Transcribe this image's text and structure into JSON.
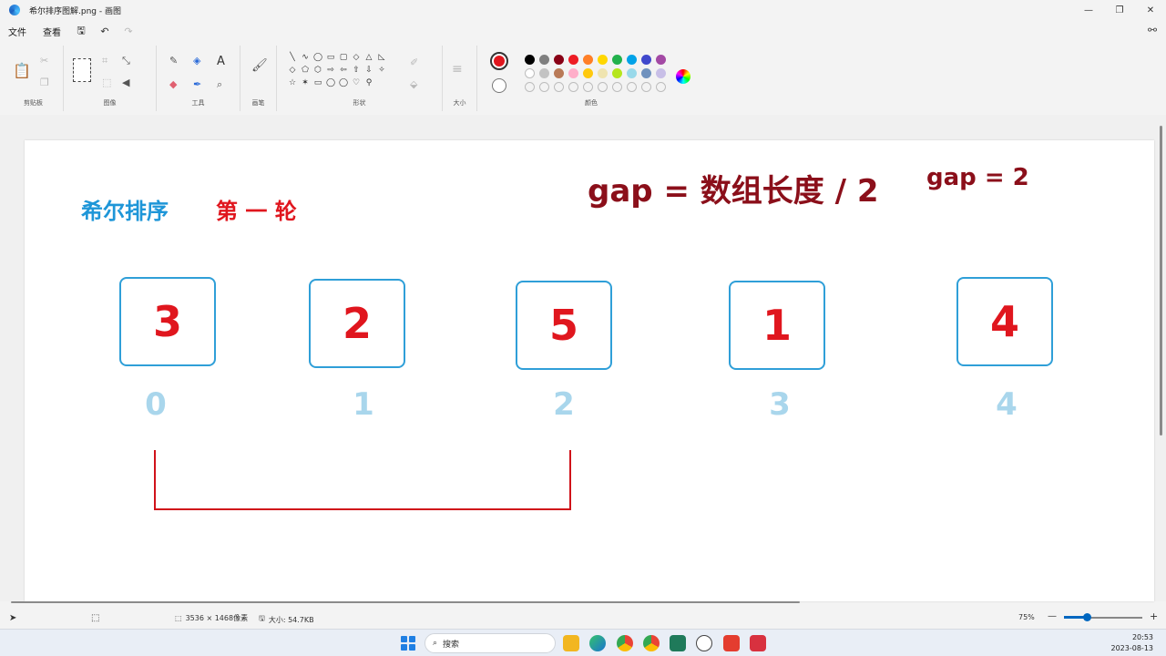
{
  "window": {
    "title": "希尔排序图解.png - 画图"
  },
  "menu": {
    "file": "文件",
    "view": "查看"
  },
  "ribbon": {
    "groups": {
      "clipboard": "剪贴板",
      "image": "图像",
      "tools": "工具",
      "brushes": "画笔",
      "shapes": "形状",
      "size": "大小",
      "colors": "颜色"
    },
    "text_tool": "A",
    "shapes": [
      "╲",
      "∿",
      "◯",
      "▭",
      "▢",
      "◇",
      "△",
      "◺",
      "◇",
      "⬠",
      "⬡",
      "⇨",
      "⇦",
      "⇧",
      "⇩",
      "✧",
      "☆",
      "✶",
      "▭",
      "◯",
      "◯",
      "♡",
      "⚲"
    ],
    "current_colors": {
      "primary": "#e0161e",
      "secondary": "#ffffff"
    },
    "palette": [
      "#000000",
      "#7f7f7f",
      "#880015",
      "#ed1c24",
      "#ff7f27",
      "#ffd700",
      "#22b14c",
      "#00a2e8",
      "#3f48cc",
      "#a349a4",
      "#ffffff",
      "#c3c3c3",
      "#b97a57",
      "#ffaec9",
      "#ffc90e",
      "#efe4b0",
      "#b5e61d",
      "#99d9ea",
      "#7092be",
      "#c8bfe7"
    ]
  },
  "canvas": {
    "title": "希尔排序",
    "round": "第 一 轮",
    "formula": "gap = 数组长度 / 2",
    "gap": "gap = 2",
    "boxes": [
      {
        "value": "3",
        "index": "0"
      },
      {
        "value": "2",
        "index": "1"
      },
      {
        "value": "5",
        "index": "2"
      },
      {
        "value": "1",
        "index": "3"
      },
      {
        "value": "4",
        "index": "4"
      }
    ],
    "colors": {
      "title": "#1e96d8",
      "round": "#e0161e",
      "formula": "#8b0f1a",
      "box_border": "#2f9fd8",
      "index": "#a9d6ec",
      "bracket": "#d0121a"
    }
  },
  "status": {
    "dimensions": "3536 × 1468像素",
    "size": "大小: 54.7KB",
    "zoom": "75%"
  },
  "taskbar": {
    "search": "搜索",
    "time": "20:53",
    "date": "2023-08-13"
  }
}
